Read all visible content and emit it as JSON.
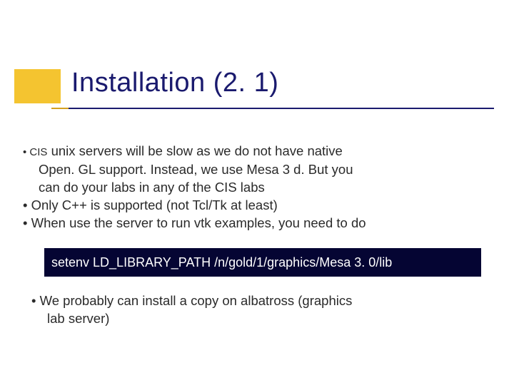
{
  "slide": {
    "title": "Installation (2. 1)",
    "bullets": {
      "b1_left": "• CIS",
      "b1_right": " unix servers will be slow  as we do not have native",
      "b1_l2": "Open. GL  support. Instead, we use Mesa 3 d. But you",
      "b1_l3": "can do your labs in any of the CIS labs",
      "b2": "• Only C++ is supported (not  Tcl/Tk at least)",
      "b3": "• When use the server to run vtk  examples, you need to do",
      "code": "setenv LD_LIBRARY_PATH /n/gold/1/graphics/Mesa 3. 0/lib",
      "b4_l1": "• We probably can install a copy on albatross (graphics",
      "b4_l2": "lab server)"
    }
  }
}
